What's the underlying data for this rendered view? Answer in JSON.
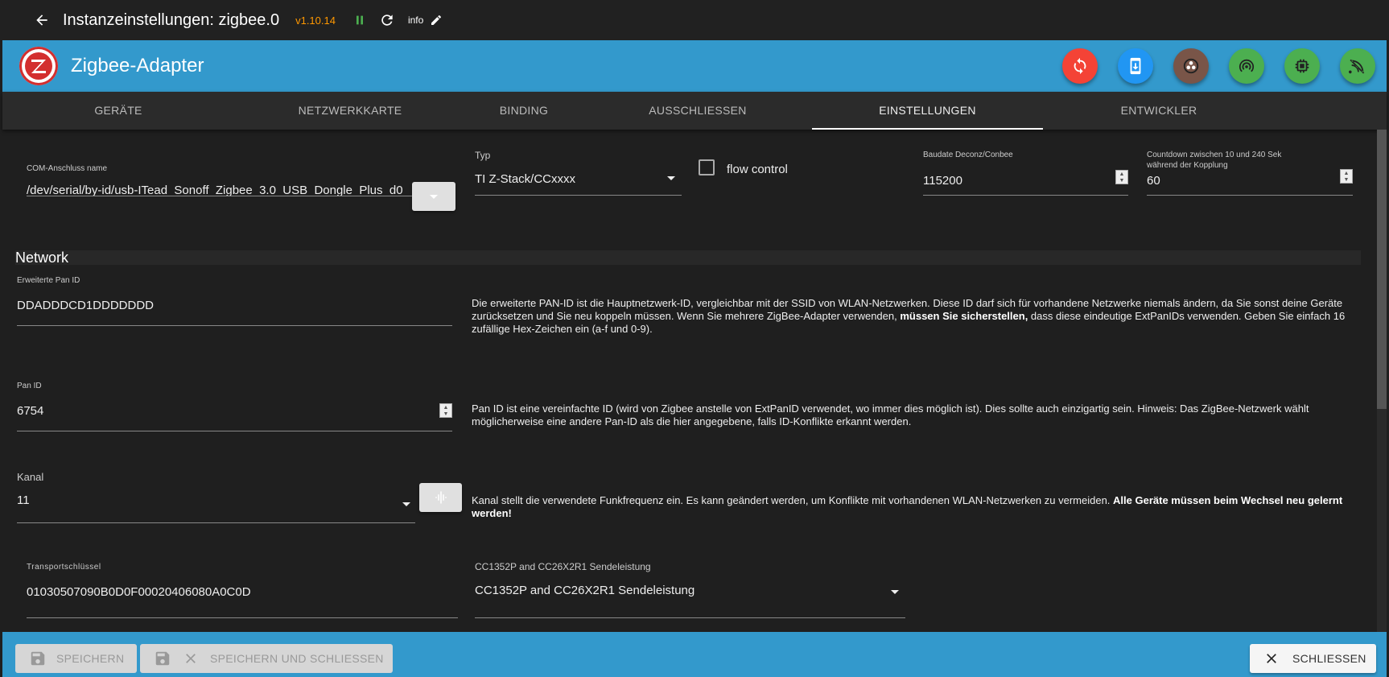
{
  "topbar": {
    "title": "Instanzeinstellungen: zigbee.0",
    "version": "v1.10.14",
    "info_label": "info"
  },
  "app": {
    "title": "Zigbee-Adapter",
    "action_icons": [
      {
        "name": "sync-icon",
        "color": "#f44336"
      },
      {
        "name": "mobile-download-icon",
        "color": "#2196f3"
      },
      {
        "name": "biohazard-icon",
        "color": "#795548"
      },
      {
        "name": "wifi-tethering-icon",
        "color": "#4caf50"
      },
      {
        "name": "memory-chip-icon",
        "color": "#4caf50"
      },
      {
        "name": "signal-off-icon",
        "color": "#4caf50"
      }
    ]
  },
  "tabs": [
    {
      "label": "GERÄTE"
    },
    {
      "label": "NETZWERKKARTE"
    },
    {
      "label": "BINDING"
    },
    {
      "label": "AUSSCHLIESSEN"
    },
    {
      "label": "EINSTELLUNGEN",
      "active": true
    },
    {
      "label": "ENTWICKLER"
    }
  ],
  "settings": {
    "com_port": {
      "label": "COM-Anschluss name",
      "value": "/dev/serial/by-id/usb-ITead_Sonoff_Zigbee_3.0_USB_Dongle_Plus_d0"
    },
    "typ": {
      "label": "Typ",
      "value": "TI Z-Stack/CCxxxx"
    },
    "flow_control": {
      "label": "flow control",
      "checked": false
    },
    "baudrate": {
      "label": "Baudate Deconz/Conbee",
      "value": "115200"
    },
    "countdown": {
      "label": "Countdown zwischen 10 und 240 Sek",
      "label2": "während der Kopplung",
      "value": "60"
    }
  },
  "network": {
    "header": "Network",
    "ext_pan_id": {
      "label": "Erweiterte Pan ID",
      "value": "DDADDDCD1DDDDDDD",
      "desc_part1": "Die erweiterte PAN-ID ist die Hauptnetzwerk-ID, vergleichbar mit der SSID von WLAN-Netzwerken. Diese ID darf sich für vorhandene Netzwerke niemals ändern, da Sie sonst deine Geräte zurücksetzen und Sie neu koppeln müssen. Wenn Sie mehrere ZigBee-Adapter verwenden, ",
      "desc_bold": "müssen Sie sicherstellen,",
      "desc_part2": " dass diese eindeutige ExtPanIDs verwenden. Geben Sie einfach 16 zufällige Hex-Zeichen ein (a-f und 0-9)."
    },
    "pan_id": {
      "label": "Pan ID",
      "value": "6754",
      "desc": "Pan ID ist eine vereinfachte ID (wird von Zigbee anstelle von ExtPanID verwendet, wo immer dies möglich ist). Dies sollte auch einzigartig sein. Hinweis: Das ZigBee-Netzwerk wählt möglicherweise eine andere Pan-ID als die hier angegebene, falls ID-Konflikte erkannt werden."
    },
    "channel": {
      "label": "Kanal",
      "value": "11",
      "desc_part1": "Kanal stellt die verwendete Funkfrequenz ein. Es kann geändert werden, um Konflikte mit vorhandenen WLAN-Netzwerken zu vermeiden. ",
      "desc_bold": "Alle Geräte müssen beim Wechsel neu gelernt werden!"
    },
    "transport_key": {
      "label": "Transportschlüssel",
      "value": "01030507090B0D0F00020406080A0C0D"
    },
    "tx_power": {
      "label": "CC1352P and CC26X2R1 Sendeleistung",
      "value": "CC1352P and CC26X2R1 Sendeleistung"
    }
  },
  "bottom": {
    "save": "SPEICHERN",
    "save_close": "SPEICHERN UND SCHLIESSEN",
    "close": "SCHLIESSEN"
  }
}
